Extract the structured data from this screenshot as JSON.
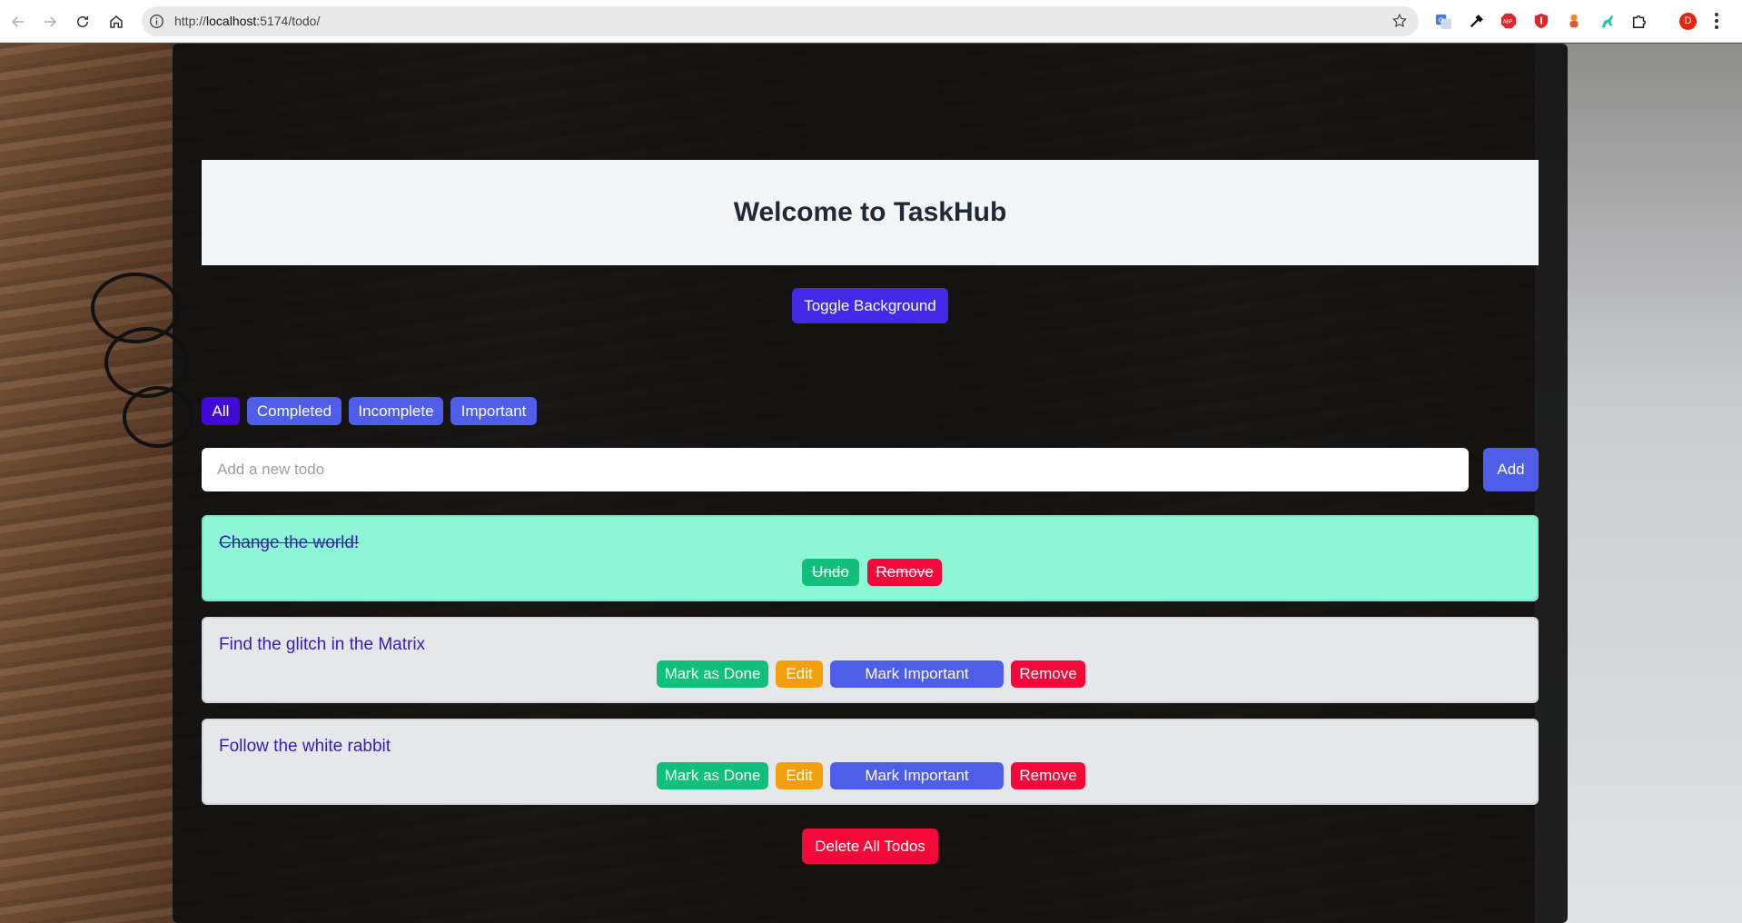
{
  "browser": {
    "url_prefix": "http://",
    "url_host": "localhost",
    "url_rest": ":5174/todo/",
    "avatar_letter": "D",
    "extensions": [
      "translate-icon",
      "eyedropper-icon",
      "adblock-icon",
      "ublock-icon",
      "puzzle-piece-icon"
    ]
  },
  "app": {
    "title": "Welcome to TaskHub",
    "toggle_background": "Toggle Background",
    "filters": [
      {
        "label": "All",
        "active": true
      },
      {
        "label": "Completed",
        "active": false
      },
      {
        "label": "Incomplete",
        "active": false
      },
      {
        "label": "Important",
        "active": false
      }
    ],
    "input_placeholder": "Add a new todo",
    "input_value": "",
    "add_label": "Add",
    "todos": [
      {
        "text": "Change the world!",
        "completed": true,
        "undo_label": "Undo",
        "remove_label": "Remove"
      },
      {
        "text": "Find the glitch in the Matrix",
        "completed": false,
        "done_label": "Mark as Done",
        "edit_label": "Edit",
        "important_label": "Mark Important",
        "remove_label": "Remove"
      },
      {
        "text": "Follow the white rabbit",
        "completed": false,
        "done_label": "Mark as Done",
        "edit_label": "Edit",
        "important_label": "Mark Important",
        "remove_label": "Remove"
      }
    ],
    "delete_all_label": "Delete All Todos"
  }
}
